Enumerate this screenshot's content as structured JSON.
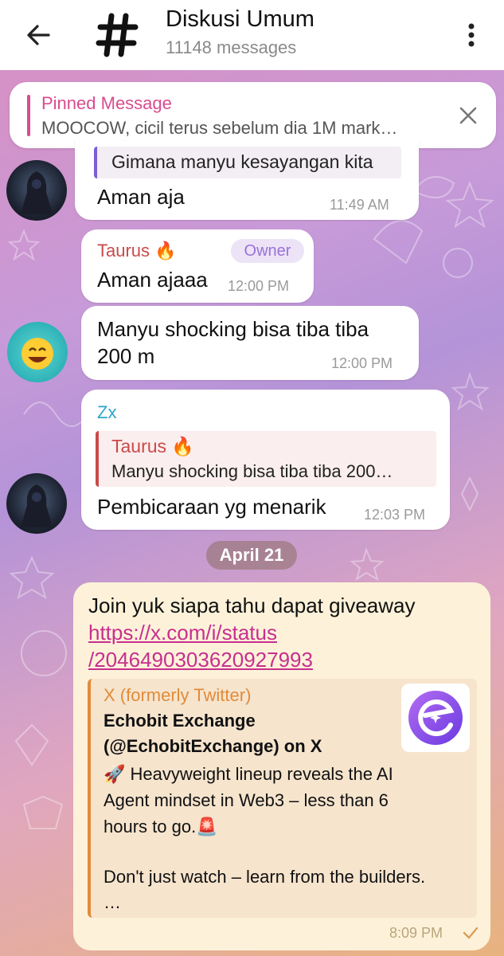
{
  "header": {
    "title": "Diskusi Umum",
    "subtitle": "11148 messages"
  },
  "pinned": {
    "label": "Pinned Message",
    "text": "MOOCOW, cicil terus sebelum dia 1M mark…"
  },
  "messages": [
    {
      "reply_text": "Gimana manyu kesayangan kita",
      "text": "Aman aja",
      "time": "11:49 AM"
    },
    {
      "sender": "Taurus 🔥",
      "badge": "Owner",
      "text": "Aman ajaaa",
      "time": "12:00 PM"
    },
    {
      "text_line1": "Manyu shocking bisa tiba tiba",
      "text_line2": "200 m",
      "time": "12:00 PM"
    },
    {
      "sender": "Zx",
      "reply_sender": "Taurus 🔥",
      "reply_text": "Manyu shocking bisa tiba tiba 200…",
      "text": "Pembicaraan yg menarik",
      "time": "12:03 PM"
    }
  ],
  "date_separator": "April 21",
  "outgoing": {
    "text": "Join yuk siapa tahu dapat giveaway",
    "link_line1": "https://x.com/i/status",
    "link_line2": "/2046490303620927993",
    "preview_site": "X (formerly Twitter)",
    "preview_title_line1": "Echobit Exchange",
    "preview_title_line2": "(@EchobitExchange) on X",
    "preview_body_line1": "🚀 Heavyweight lineup reveals the AI",
    "preview_body_line2": "Agent mindset in Web3 – less than 6",
    "preview_body_line3": "hours to go.🚨",
    "preview_body_line4": "Don't just watch – learn from the builders.",
    "preview_body_line5": "…",
    "time": "8:09 PM"
  },
  "colors": {
    "pinned_accent": "#d94c8e",
    "taurus_name": "#c94a4a",
    "zx_name": "#2ea6c6",
    "owner_badge": "#9a72d8",
    "link": "#c72f8f",
    "preview_site": "#e08c3a"
  }
}
